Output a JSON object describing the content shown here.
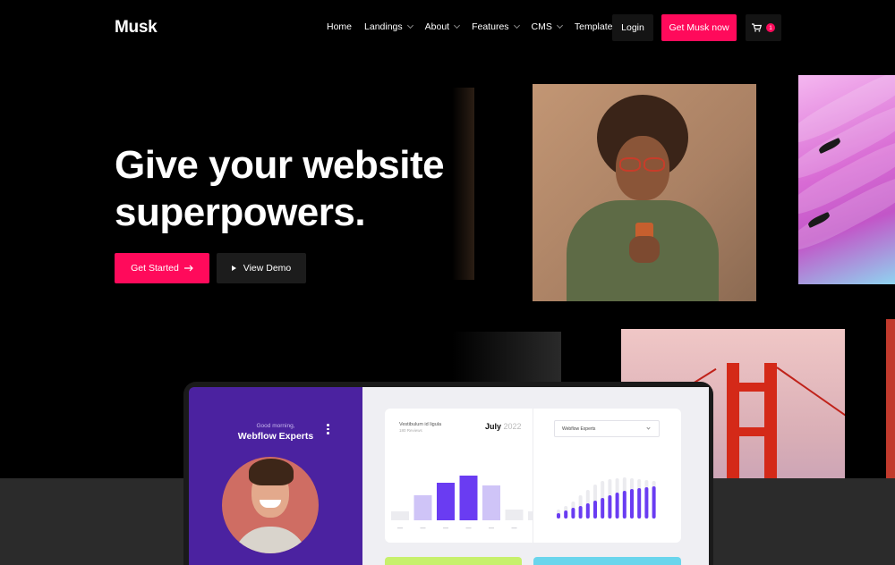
{
  "brand": {
    "logo": "Musk"
  },
  "nav": {
    "items": [
      {
        "label": "Home",
        "has_dropdown": false
      },
      {
        "label": "Landings",
        "has_dropdown": true
      },
      {
        "label": "About",
        "has_dropdown": true
      },
      {
        "label": "Features",
        "has_dropdown": true
      },
      {
        "label": "CMS",
        "has_dropdown": true
      },
      {
        "label": "Template",
        "has_dropdown": true
      }
    ],
    "login_label": "Login",
    "cta_label": "Get Musk now",
    "cart_count": "1"
  },
  "hero": {
    "title_line1": "Give your website",
    "title_line2": "superpowers.",
    "primary_label": "Get Started",
    "secondary_label": "View Demo"
  },
  "dashboard": {
    "greeting": "Good morning,",
    "name": "Webflow Experts",
    "card_title": "Vestibulum id ligula",
    "card_subtitle": "180 Reviews",
    "month": "July",
    "year": "2022",
    "select_value": "Webflow Experts",
    "bar_values": [
      0.1,
      0.28,
      0.42,
      0.5,
      0.39,
      0.12,
      0.1
    ],
    "bar_highlight": [
      false,
      false,
      true,
      true,
      false,
      false,
      false
    ],
    "lolli_values": [
      0.06,
      0.09,
      0.12,
      0.14,
      0.17,
      0.2,
      0.23,
      0.26,
      0.29,
      0.31,
      0.33,
      0.34,
      0.35,
      0.36
    ],
    "lolli_bg_values": [
      0.1,
      0.14,
      0.19,
      0.26,
      0.32,
      0.38,
      0.42,
      0.44,
      0.45,
      0.46,
      0.45,
      0.44,
      0.43,
      0.42
    ]
  },
  "colors": {
    "accent": "#ff0a5b",
    "dashboard_purple": "#4b22a0",
    "bar_purple": "#6a3cf2",
    "bar_light": "#cfc4f7"
  }
}
